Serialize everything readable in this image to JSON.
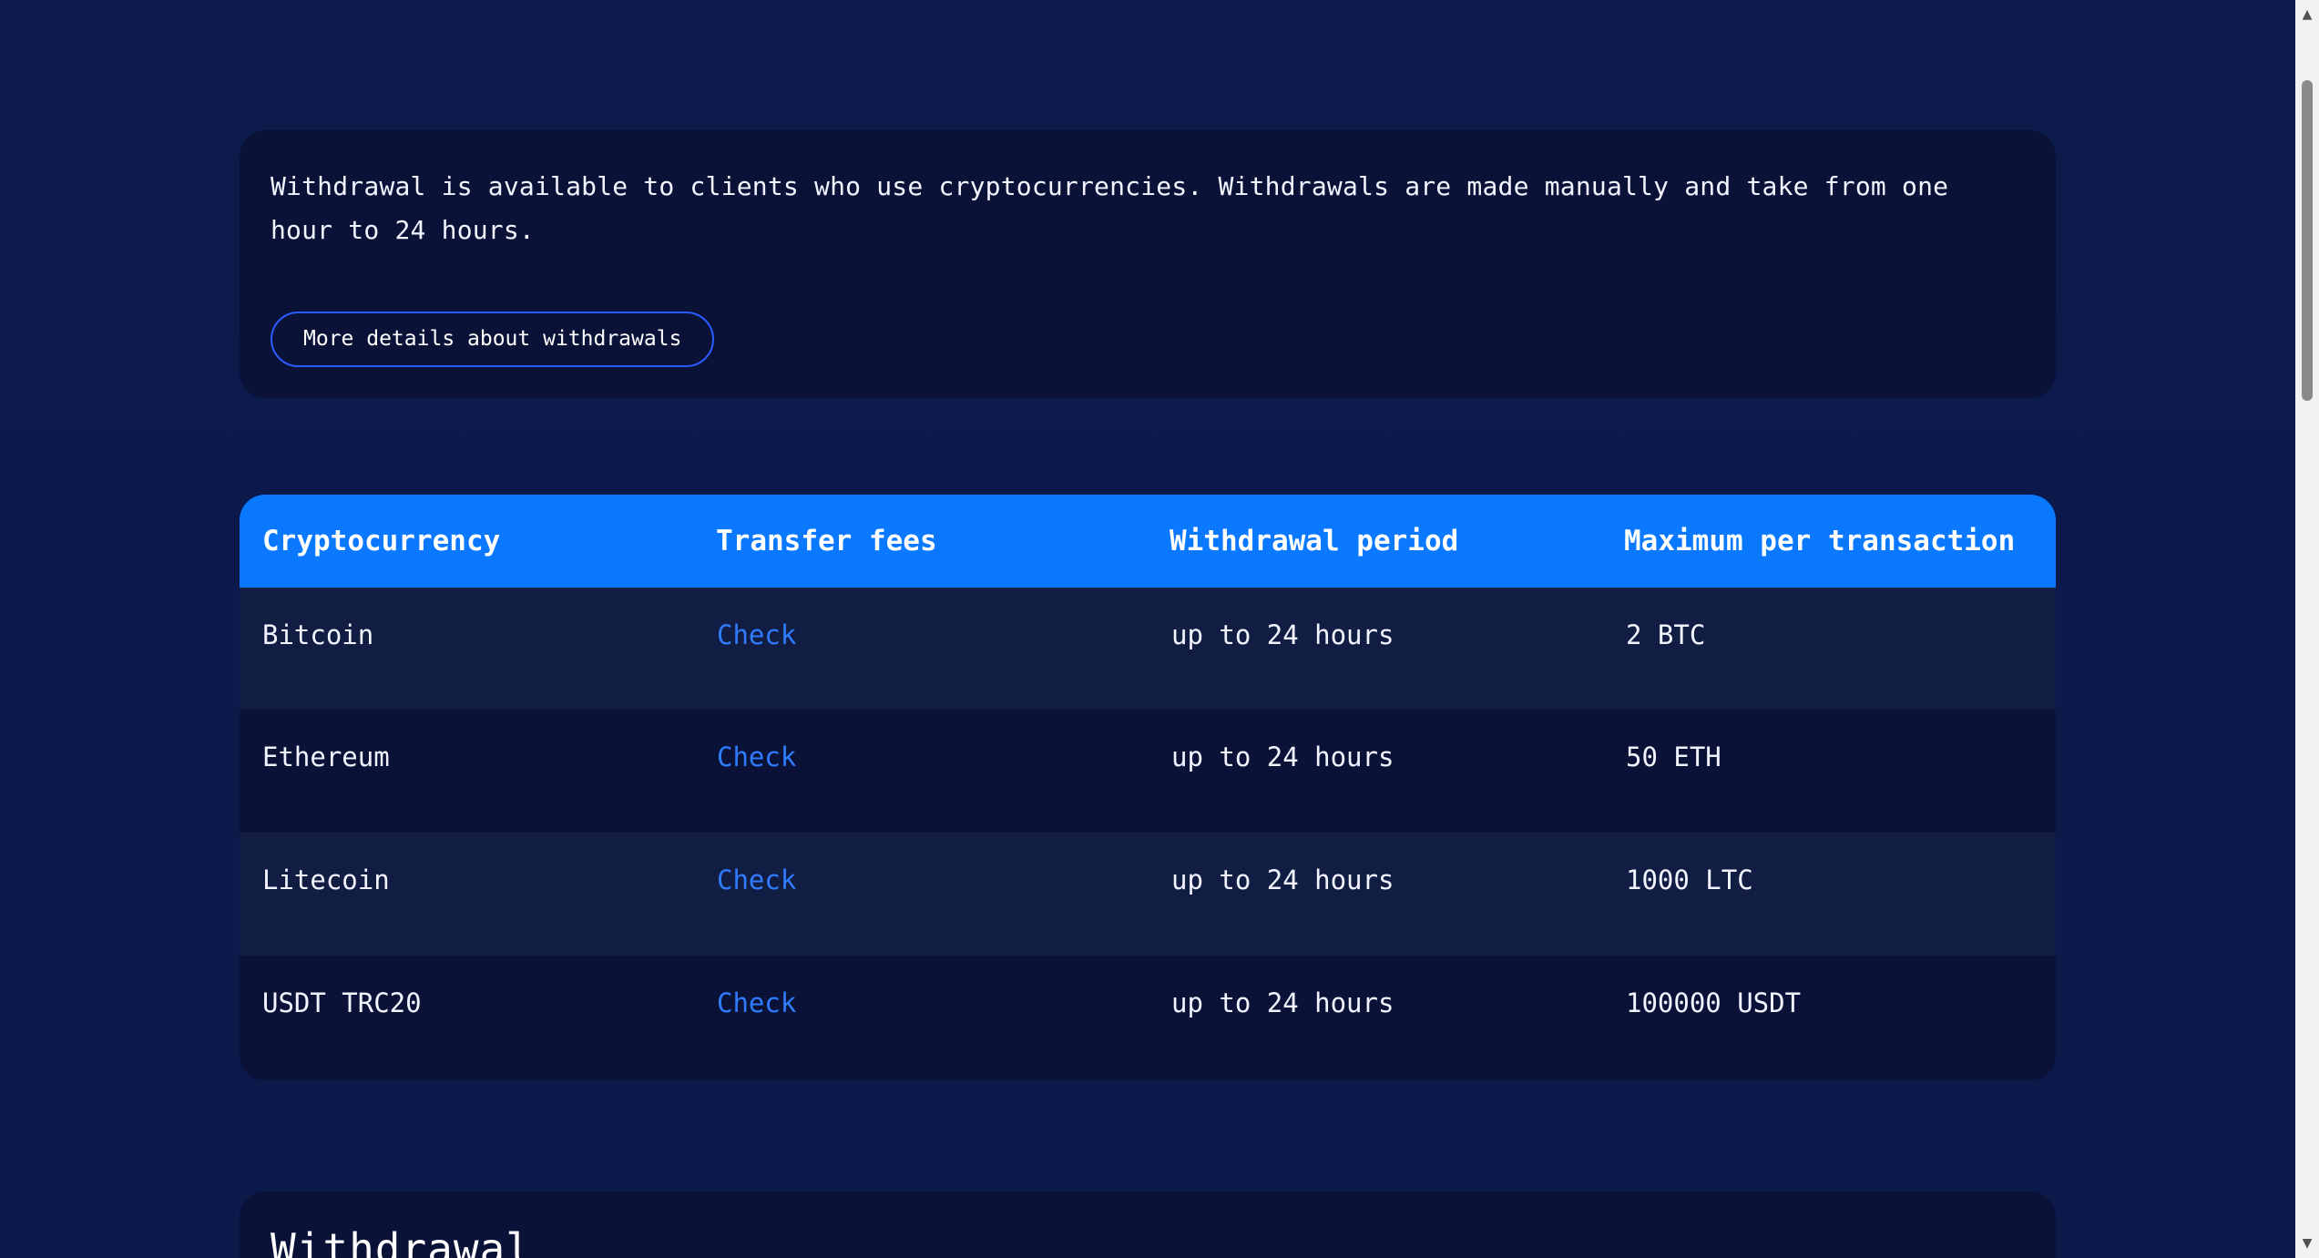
{
  "info": {
    "text": "Withdrawal is available to clients who use cryptocurrencies. Withdrawals are made manually and take from one hour to 24 hours.",
    "button_label": "More details about withdrawals"
  },
  "table": {
    "headers": [
      "Cryptocurrency",
      "Transfer fees",
      "Withdrawal period",
      "Maximum per transaction"
    ],
    "rows": [
      {
        "currency": "Bitcoin",
        "fees": "Check",
        "period": "up to 24 hours",
        "max": "2 BTC"
      },
      {
        "currency": "Ethereum",
        "fees": "Check",
        "period": "up to 24 hours",
        "max": "50 ETH"
      },
      {
        "currency": "Litecoin",
        "fees": "Check",
        "period": "up to 24 hours",
        "max": "1000 LTC"
      },
      {
        "currency": "USDT TRC20",
        "fees": "Check",
        "period": "up to 24 hours",
        "max": "100000 USDT"
      }
    ]
  },
  "section": {
    "title": "Withdrawal"
  },
  "colors": {
    "background": "#0b1a4a",
    "card": "#0a1238",
    "header_blue": "#0a78ff",
    "link_blue": "#2f7cff"
  },
  "icons": {
    "scroll_up": "triangle-up-icon",
    "scroll_down": "triangle-down-icon"
  }
}
